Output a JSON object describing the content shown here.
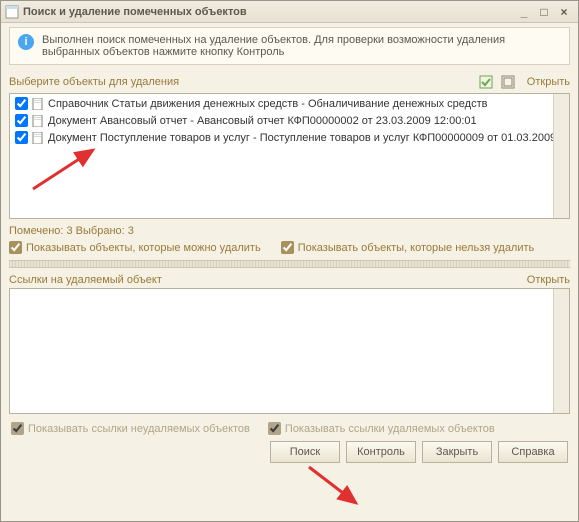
{
  "window": {
    "title": "Поиск и удаление помеченных объектов"
  },
  "info": {
    "text": "Выполнен поиск помеченных на удаление объектов. Для проверки возможности удаления выбранных объектов нажмите кнопку Контроль"
  },
  "selection": {
    "label": "Выберите объекты для удаления",
    "open": "Открыть",
    "items": [
      {
        "checked": true,
        "text": "Справочник Статьи движения денежных средств - Обналичивание денежных средств"
      },
      {
        "checked": true,
        "text": "Документ Авансовый отчет - Авансовый отчет КФП00000002 от 23.03.2009 12:00:01"
      },
      {
        "checked": true,
        "text": "Документ Поступление товаров и услуг - Поступление товаров и услуг КФП00000009 от 01.03.2009 ..."
      }
    ]
  },
  "status": {
    "text": "Помечено: 3  Выбрано: 3"
  },
  "filters": {
    "show_deletable": "Показывать объекты, которые можно удалить",
    "show_nondeletable": "Показывать объекты, которые нельзя удалить"
  },
  "refs": {
    "label": "Ссылки на удаляемый объект",
    "open": "Открыть"
  },
  "bottom_filters": {
    "show_nondeletable_refs": "Показывать ссылки неудаляемых объектов",
    "show_deletable_refs": "Показывать ссылки удаляемых объектов"
  },
  "buttons": {
    "search": "Поиск",
    "control": "Контроль",
    "close": "Закрыть",
    "help": "Справка"
  }
}
